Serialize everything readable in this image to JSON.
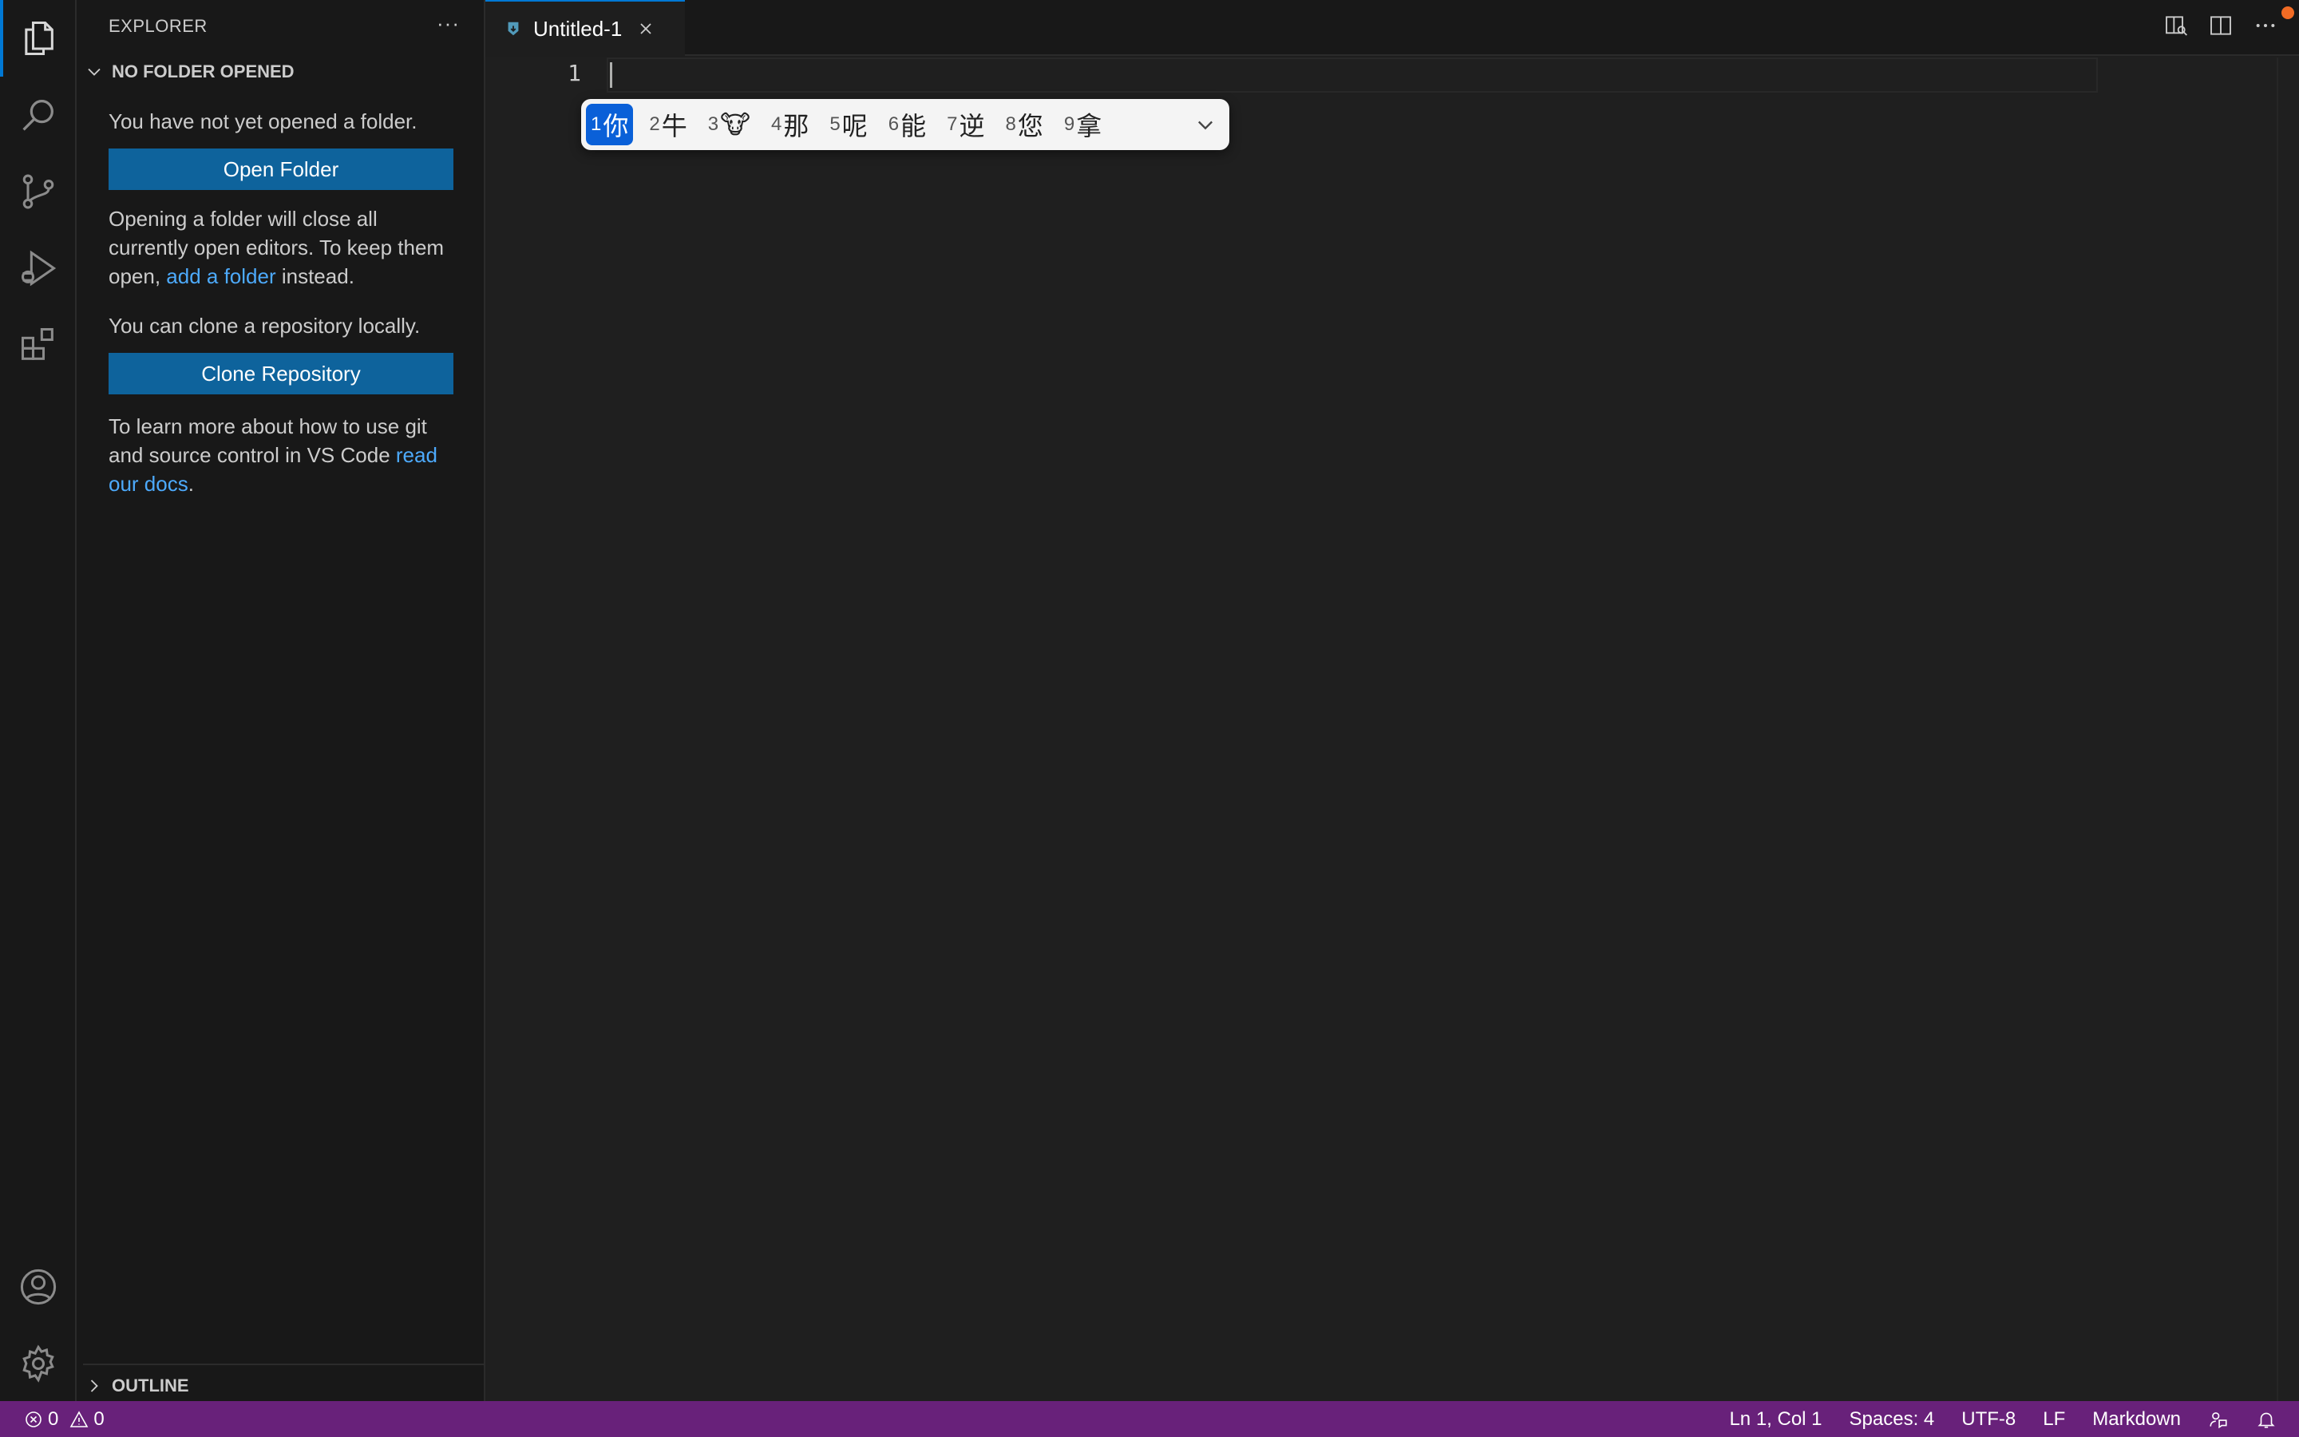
{
  "colors": {
    "accent": "#0078d4",
    "button": "#0e639c",
    "link": "#4daafc",
    "status_bar": "#68217a",
    "ime_selected": "#0a60d8",
    "notification_dot": "#f16b24"
  },
  "activity_bar": {
    "items": [
      {
        "name": "explorer",
        "icon": "files-icon"
      },
      {
        "name": "search",
        "icon": "search-icon"
      },
      {
        "name": "source-control",
        "icon": "source-control-icon"
      },
      {
        "name": "run-and-debug",
        "icon": "run-debug-icon"
      },
      {
        "name": "extensions",
        "icon": "extensions-icon"
      }
    ],
    "bottom": [
      {
        "name": "accounts",
        "icon": "account-icon"
      },
      {
        "name": "manage",
        "icon": "gear-icon"
      }
    ]
  },
  "sidebar": {
    "title": "EXPLORER",
    "more": "···",
    "section_title": "NO FOLDER OPENED",
    "message": "You have not yet opened a folder.",
    "open_folder_label": "Open Folder",
    "close_note_part1": "Opening a folder will close all currently open editors. To keep them open, ",
    "close_note_link": "add a folder",
    "close_note_part2": " instead.",
    "clone_message": "You can clone a repository locally.",
    "clone_label": "Clone Repository",
    "learn_part1": "To learn more about how to use git and source control in VS Code ",
    "learn_link": "read our docs",
    "learn_part2": ".",
    "outline_title": "OUTLINE"
  },
  "tabs": [
    {
      "label": "Untitled-1",
      "icon": "markdown-icon",
      "active": true
    }
  ],
  "editor": {
    "line_numbers": [
      "1"
    ]
  },
  "ime": {
    "candidates": [
      {
        "num": "1",
        "text": "你",
        "selected": true
      },
      {
        "num": "2",
        "text": "牛"
      },
      {
        "num": "3",
        "text": "🐮"
      },
      {
        "num": "4",
        "text": "那"
      },
      {
        "num": "5",
        "text": "呢"
      },
      {
        "num": "6",
        "text": "能"
      },
      {
        "num": "7",
        "text": "逆"
      },
      {
        "num": "8",
        "text": "您"
      },
      {
        "num": "9",
        "text": "拿"
      }
    ]
  },
  "status_bar": {
    "errors": "0",
    "warnings": "0",
    "position": "Ln 1, Col 1",
    "spaces": "Spaces: 4",
    "encoding": "UTF-8",
    "eol": "LF",
    "language": "Markdown"
  }
}
